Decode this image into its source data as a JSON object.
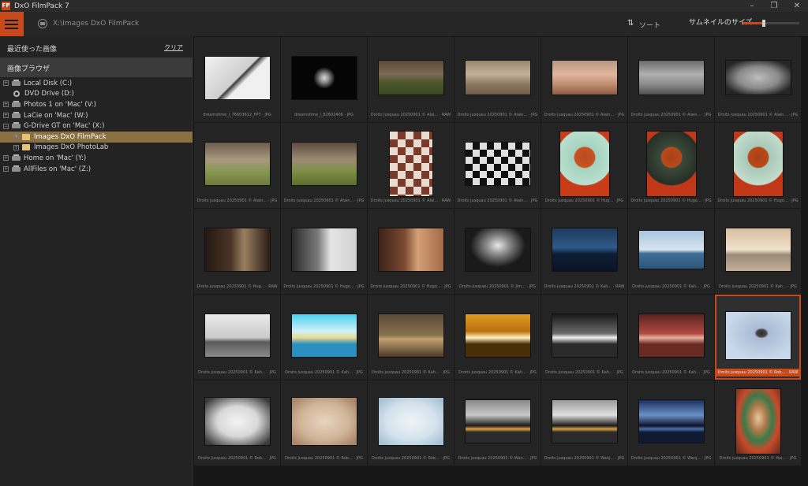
{
  "window": {
    "app_icon_text": "FP",
    "title": "DxO FilmPack 7",
    "minimize_glyph": "–",
    "restore_glyph": "❐",
    "close_glyph": "✕"
  },
  "toolbar": {
    "path": "X:\\Images DxO FilmPack",
    "sort_glyph": "⇅",
    "sort_label": "ソート",
    "thumb_size_label": "サムネイルのサイズ",
    "thumb_size_level": 0.38,
    "accent": "#c84a1c"
  },
  "sidebar": {
    "recent_label": "最近使った画像",
    "clear_label": "クリア",
    "browser_label": "画像ブラウザ",
    "tree": [
      {
        "label": "Local Disk (C:)",
        "icon": "drive-icon",
        "depth": 0,
        "expander": "+"
      },
      {
        "label": "DVD Drive (D:)",
        "icon": "disc-icon",
        "depth": 0,
        "expander": ""
      },
      {
        "label": "Photos 1 on 'Mac' (V:)",
        "icon": "drive-icon",
        "depth": 0,
        "expander": "+"
      },
      {
        "label": "LaCie on 'Mac' (W:)",
        "icon": "drive-icon",
        "depth": 0,
        "expander": "+"
      },
      {
        "label": "G-Drive GT on 'Mac' (X:)",
        "icon": "drive-icon",
        "depth": 0,
        "expander": "−"
      },
      {
        "label": "Images DxO FilmPack",
        "icon": "folder-icon",
        "depth": 1,
        "expander": "+",
        "selected": true
      },
      {
        "label": "Images DxO PhotoLab",
        "icon": "folder-icon",
        "depth": 1,
        "expander": "+"
      },
      {
        "label": "Home on 'Mac' (Y:)",
        "icon": "drive-icon",
        "depth": 0,
        "expander": "+"
      },
      {
        "label": "AllFiles on 'Mac' (Z:)",
        "icon": "drive-icon",
        "depth": 0,
        "expander": "+"
      }
    ]
  },
  "grid": {
    "items": [
      {
        "caption": "dreamstime_l_76603612_FP7 · JPG",
        "w": 84,
        "h": 56,
        "bg": "linear-gradient(135deg,#f2f2f2,#cfcfcf 50%,#3a3a3a 52%,#f0f0f0 60%)"
      },
      {
        "caption": "dreamstime_l_82602406 · JPG",
        "w": 84,
        "h": 56,
        "bg": "radial-gradient(circle at 50% 50%,#d8d8d8 0,#8a8a8a 12%,#050505 28%)"
      },
      {
        "caption": "Droits jusquau 20250901 © Alai... · RAW",
        "w": 84,
        "h": 45,
        "bg": "linear-gradient(180deg,#5a4a3a 0,#7d6a55 40%,#4f5a2e 62%,#394720)"
      },
      {
        "caption": "Droits jusquau 20250901 © Alain... · JPG",
        "w": 84,
        "h": 45,
        "bg": "linear-gradient(180deg,#9a8670 0,#c4b199 40%,#8c7860 70%,#6f5c47)"
      },
      {
        "caption": "Droits jusquau 20250901 © Alain... · JPG",
        "w": 84,
        "h": 45,
        "bg": "linear-gradient(180deg,#b89682 0,#e2b69e 40%,#c08d70 70%,#8c5c44)"
      },
      {
        "caption": "Droits jusquau 20250901 © Alain... · JPG",
        "w": 84,
        "h": 45,
        "bg": "linear-gradient(180deg,#6a6a6a 0,#b0b0b0 40%,#8a8a8a 70%,#505050)"
      },
      {
        "caption": "Droits jusquau 20250901 © Alain... · JPG",
        "w": 84,
        "h": 45,
        "bg": "radial-gradient(ellipse at 50% 50%,#bdbdbd 0,#8a8a8a 45%,#262626 80%)"
      },
      {
        "caption": "Droits jusquau 20250901 © Alain... · JPG",
        "w": 84,
        "h": 56,
        "bg": "linear-gradient(180deg,#6b5d4d 0,#a8987e 40%,#8a9a56 65%,#6e7a3a)"
      },
      {
        "caption": "Droits jusquau 20250901 © Alain... · JPG",
        "w": 84,
        "h": 56,
        "bg": "linear-gradient(180deg,#5c4b3d 0,#9a8a75 40%,#809048 65%,#5e6d2c)"
      },
      {
        "caption": "Droits jusquau 20250901 © Alai... · RAW",
        "w": 56,
        "h": 84,
        "bg": "repeating-conic-gradient(#7a3a2a 0 25%,#e8dcd0 0 50%) 0 0/20px 20px"
      },
      {
        "caption": "Droits jusquau 20250901 © Alain... · JPG",
        "w": 84,
        "h": 56,
        "bg": "repeating-conic-gradient(#111 0 25%,#e0e0e0 0 50%) 0 0/18px 18px"
      },
      {
        "caption": "Droits jusquau 20250901 © Hug... · JPG",
        "w": 64,
        "h": 84,
        "bg": "radial-gradient(circle at 50% 40%,#b84b22 0,#c9551f 22%,#a7d2c0 24%,#b8e0cf 60%,#c83c1a 62%)"
      },
      {
        "caption": "Droits jusquau 20250901 © Hugo... · JPG",
        "w": 64,
        "h": 84,
        "bg": "radial-gradient(circle at 50% 40%,#a84018 0,#b84a1a 22%,#3a4a3a 24%,#262e26 60%,#c03818 62%)"
      },
      {
        "caption": "Droits jusquau 20250901 © Hugo... · JPG",
        "w": 64,
        "h": 84,
        "bg": "radial-gradient(circle at 50% 40%,#a84018 0,#b84a1a 22%,#a8c8b8 24%,#c4dccc 60%,#c03818 62%)"
      },
      {
        "caption": "Droits jusquau 20250901 © Hug... · RAW",
        "w": 84,
        "h": 56,
        "bg": "linear-gradient(90deg,#241812 0,#4a3526 40%,#9a8060 60%,#2a1c14)"
      },
      {
        "caption": "Droits jusquau 20250901 © Hugo... · JPG",
        "w": 84,
        "h": 56,
        "bg": "linear-gradient(90deg,#2a2a2a 0,#7a7a7a 40%,#e6e6e6 60%,#cfcfcf)"
      },
      {
        "caption": "Droits jusquau 20250901 © Hugo... · JPG",
        "w": 84,
        "h": 56,
        "bg": "linear-gradient(90deg,#3c2218 0,#7a4a32 40%,#d4a076 60%,#a36a48)"
      },
      {
        "caption": "Droits jusquau 20250901 © Jim... · JPG",
        "w": 84,
        "h": 56,
        "bg": "radial-gradient(ellipse at 50% 40%,#e8e8e8 0,#8a8a8a 25%,#1a1a1a 60%)"
      },
      {
        "caption": "Droits jusquau 20250901 © Kah... · RAW",
        "w": 84,
        "h": 56,
        "bg": "linear-gradient(180deg,#1e3a5a 0,#2e5a8a 45%,#0e1e34 60%,#0a1426)"
      },
      {
        "caption": "Droits jusquau 20250901 © Kah... · JPG",
        "w": 84,
        "h": 50,
        "bg": "linear-gradient(180deg,#a8c4e0 0,#d8e4ee 50%,#3e6e96 60%,#2c567c)"
      },
      {
        "caption": "Droits jusquau 20250901 © Kah... · JPG",
        "w": 84,
        "h": 56,
        "bg": "linear-gradient(180deg,#d8c0a0 0,#f0e0cc 50%,#9a8a78 62%,#c4b098)"
      },
      {
        "caption": "Droits jusquau 20250901 © Kah... · JPG",
        "w": 84,
        "h": 56,
        "bg": "linear-gradient(180deg,#eaeaea 0,#cacaca 55%,#5a5a5a 65%,#8a8a8a)"
      },
      {
        "caption": "Droits jusquau 20250901 © Kah... · JPG",
        "w": 84,
        "h": 56,
        "bg": "linear-gradient(180deg,#4ad0f0 0,#d0f0f8 40%,#e8d890 55%,#2a90c0 70%)"
      },
      {
        "caption": "Droits jusquau 20250901 © Kah... · JPG",
        "w": 84,
        "h": 56,
        "bg": "linear-gradient(180deg,#5a4a36 0,#8a7452 50%,#c4a070 58%,#4a3a28)"
      },
      {
        "caption": "Droits jusquau 20250901 © Kah... · JPG",
        "w": 84,
        "h": 56,
        "bg": "linear-gradient(180deg,#e09a20 0,#b8700e 40%,#fff2c0 55%,#4a2e08 70%)"
      },
      {
        "caption": "Droits jusquau 20250901 © Kah... · JPG",
        "w": 84,
        "h": 56,
        "bg": "linear-gradient(180deg,#1a1a1a 0,#6a6a6a 45%,#f0f0f0 55%,#2a2a2a 70%)"
      },
      {
        "caption": "Droits jusquau 20250901 © Kah... · JPG",
        "w": 84,
        "h": 56,
        "bg": "linear-gradient(180deg,#5a2420 0,#b04a40 45%,#e8b0a0 55%,#6a2a24 70%)"
      },
      {
        "caption": "Droits jusquau 20250901 © Rob... · RAW",
        "w": 84,
        "h": 62,
        "bg": "radial-gradient(ellipse at 55% 45%,#2a2a2a 0,#4a4a4a 10%,#a8bcd4 14%,#c8d8ea 70%)",
        "selected": true
      },
      {
        "caption": "Droits jusquau 20250901 © Rob... · JPG",
        "w": 84,
        "h": 62,
        "bg": "radial-gradient(ellipse at 50% 50%,#f4f4f4 0,#d8d8d8 45%,#3a3a3a 90%)"
      },
      {
        "caption": "Droits jusquau 20250901 © Rob... · JPG",
        "w": 84,
        "h": 62,
        "bg": "radial-gradient(ellipse at 50% 50%,#e8d4c0 0,#d0b498 55%,#a8866a 90%)"
      },
      {
        "caption": "Droits jusquau 20250901 © Rob... · JPG",
        "w": 84,
        "h": 62,
        "bg": "radial-gradient(ellipse at 50% 50%,#eef4f8 0,#d4e2ec 55%,#a8c2d4 90%)"
      },
      {
        "caption": "Droits jusquau 20250901 © Wan... · JPG",
        "w": 84,
        "h": 56,
        "bg": "linear-gradient(180deg,#888 0,#c8c8c8 35%,#1a1a1a 60%,#e0a040 68%,#2a2a2a 75%)"
      },
      {
        "caption": "Droits jusquau 20250901 © Wanj... · JPG",
        "w": 84,
        "h": 56,
        "bg": "linear-gradient(180deg,#9a9a9a 0,#e0e0e0 35%,#1a1a1a 60%,#d8a040 68%,#2a2a2a 75%)"
      },
      {
        "caption": "Droits jusquau 20250901 © Wanj... · JPG",
        "w": 84,
        "h": 56,
        "bg": "linear-gradient(180deg,#1a2e5a 0,#6a90c8 35%,#0e1428 60%,#4a70b0 68%,#101a30 75%)"
      },
      {
        "caption": "Droits jusquau 20250901 © Yoa... · JPG",
        "w": 58,
        "h": 84,
        "bg": "radial-gradient(ellipse at 50% 45%,#e8c8a0 0,#b07a4a 25%,#3a7a4a 45%,#c84a2a 65%,#5a2a1a)"
      }
    ]
  }
}
